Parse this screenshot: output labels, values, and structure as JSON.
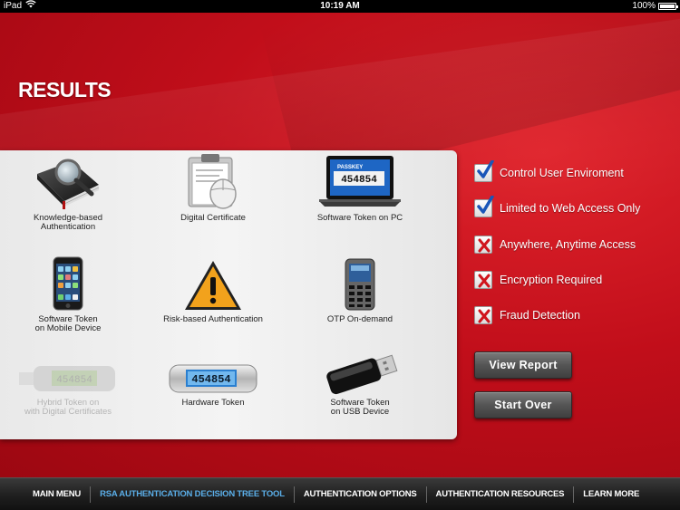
{
  "status_bar": {
    "device": "iPad",
    "time": "10:19 AM",
    "battery": "100%"
  },
  "page": {
    "title": "RESULTS"
  },
  "results": [
    {
      "label_lines": [
        "Knowledge-based",
        "Authentication"
      ],
      "enabled": true,
      "icon": "book-magnifier-icon"
    },
    {
      "label_lines": [
        "Digital Certificate",
        ""
      ],
      "enabled": true,
      "icon": "certificate-clipboard-icon"
    },
    {
      "label_lines": [
        "Software Token on PC",
        ""
      ],
      "enabled": true,
      "icon": "laptop-token-icon",
      "screen_text": "454854",
      "screen_header": "PASSKEY"
    },
    {
      "label_lines": [
        "Software Token",
        "on Mobile Device"
      ],
      "enabled": true,
      "icon": "smartphone-icon"
    },
    {
      "label_lines": [
        "Risk-based Authentication",
        ""
      ],
      "enabled": true,
      "icon": "warning-triangle-icon"
    },
    {
      "label_lines": [
        "OTP On-demand",
        ""
      ],
      "enabled": true,
      "icon": "phone-keypad-icon"
    },
    {
      "label_lines": [
        "Hybrid Token on",
        "with Digital Certificates"
      ],
      "enabled": false,
      "icon": "hybrid-usb-token-icon",
      "screen_text": "454854"
    },
    {
      "label_lines": [
        "Hardware Token",
        ""
      ],
      "enabled": true,
      "icon": "hardware-token-icon",
      "screen_text": "454854"
    },
    {
      "label_lines": [
        "Software Token",
        "on USB Device"
      ],
      "enabled": true,
      "icon": "usb-drive-icon"
    }
  ],
  "criteria": [
    {
      "label": "Control User Enviroment",
      "checked": true
    },
    {
      "label": "Limited to Web Access Only",
      "checked": true
    },
    {
      "label": "Anywhere, Anytime Access",
      "checked": false
    },
    {
      "label": "Encryption Required",
      "checked": false
    },
    {
      "label": "Fraud Detection",
      "checked": false
    }
  ],
  "buttons": {
    "view_report": "View Report",
    "start_over": "Start Over"
  },
  "nav": {
    "items": [
      {
        "label": "MAIN MENU",
        "active": false
      },
      {
        "label": "RSA AUTHENTICATION DECISION TREE TOOL",
        "active": true
      },
      {
        "label": "AUTHENTICATION OPTIONS",
        "active": false
      },
      {
        "label": "AUTHENTICATION RESOURCES",
        "active": false
      },
      {
        "label": "LEARN MORE",
        "active": false
      }
    ]
  },
  "colors": {
    "background_red": "#c10e1a",
    "nav_active": "#5aaee8",
    "check_blue": "#1a56b8",
    "cross_red": "#d0141c"
  }
}
